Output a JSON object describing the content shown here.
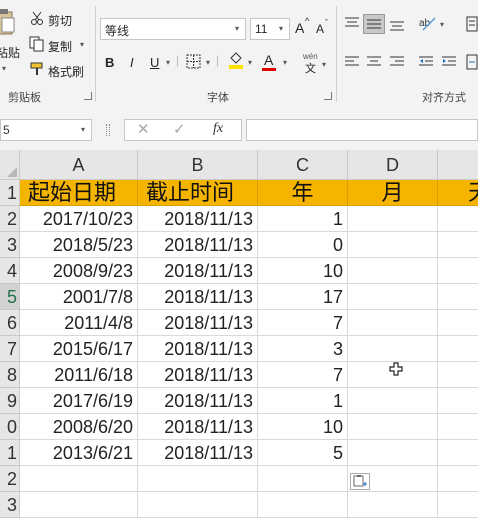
{
  "ribbon": {
    "clipboard": {
      "paste_label": "粘贴",
      "cut_label": "剪切",
      "copy_label": "复制",
      "format_painter_label": "格式刷",
      "group_label": "剪贴板"
    },
    "font": {
      "font_name": "等线",
      "font_size": "11",
      "bold_label": "B",
      "italic_label": "I",
      "underline_label": "U",
      "font_color_label": "A",
      "phonetic_top": "wén",
      "phonetic_bottom": "文",
      "group_label": "字体",
      "grow_label": "A",
      "shrink_label": "A"
    },
    "alignment": {
      "group_label": "对齐方式"
    }
  },
  "formula_bar": {
    "name_box": "5",
    "fx_label": "fx",
    "formula_value": ""
  },
  "sheet": {
    "columns": [
      "A",
      "B",
      "C",
      "D"
    ],
    "partial_column_header": "",
    "row_numbers": [
      "1",
      "2",
      "3",
      "4",
      "5",
      "6",
      "7",
      "8",
      "9",
      "0",
      "1",
      "2",
      "3"
    ],
    "headers": {
      "A": "起始日期",
      "B": "截止时间",
      "C": "年",
      "D": "月",
      "E": "天"
    },
    "rows": [
      {
        "start": "2017/10/23",
        "end": "2018/11/13",
        "years": "1"
      },
      {
        "start": "2018/5/23",
        "end": "2018/11/13",
        "years": "0"
      },
      {
        "start": "2008/9/23",
        "end": "2018/11/13",
        "years": "10"
      },
      {
        "start": "2001/7/8",
        "end": "2018/11/13",
        "years": "17"
      },
      {
        "start": "2011/4/8",
        "end": "2018/11/13",
        "years": "7"
      },
      {
        "start": "2015/6/17",
        "end": "2018/11/13",
        "years": "3"
      },
      {
        "start": "2011/6/18",
        "end": "2018/11/13",
        "years": "7"
      },
      {
        "start": "2017/6/19",
        "end": "2018/11/13",
        "years": "1"
      },
      {
        "start": "2008/6/20",
        "end": "2018/11/13",
        "years": "10"
      },
      {
        "start": "2013/6/21",
        "end": "2018/11/13",
        "years": "5"
      }
    ]
  },
  "colors": {
    "header_fill": "#f4b400",
    "excel_green": "#217346"
  }
}
